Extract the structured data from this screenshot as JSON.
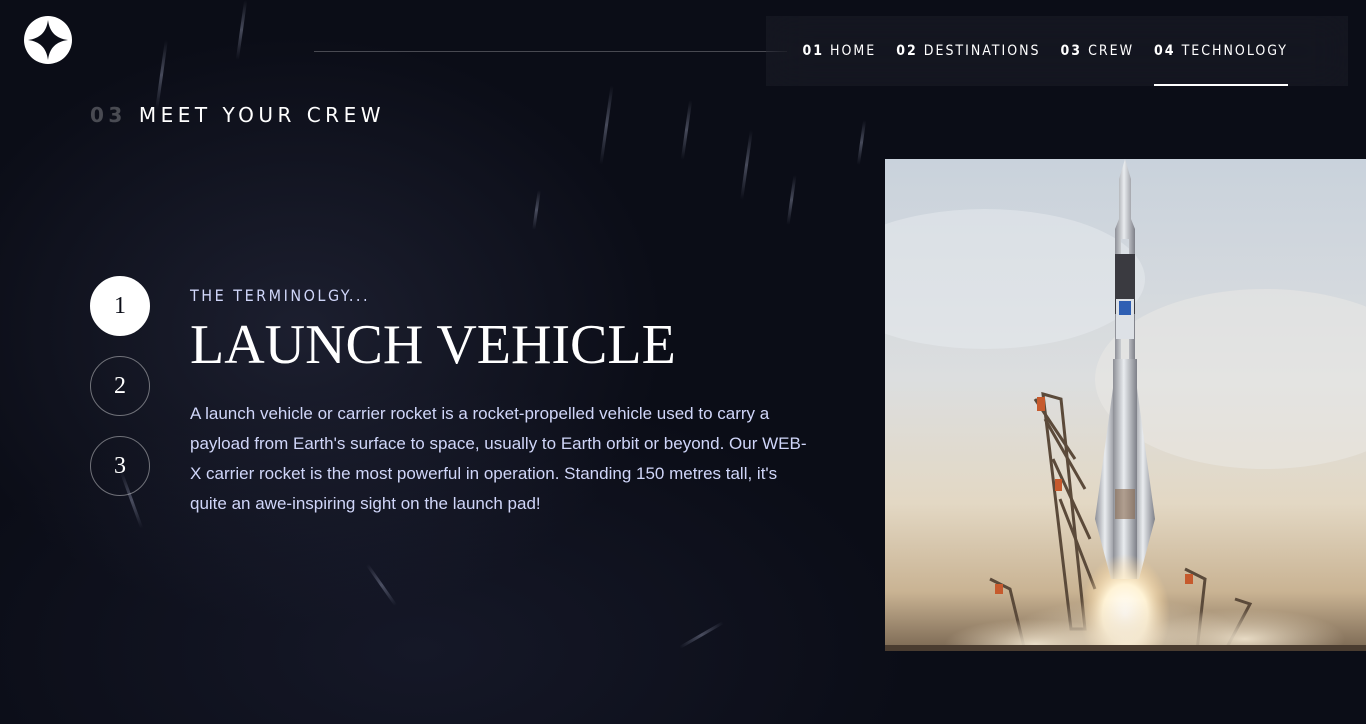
{
  "nav": {
    "items": [
      {
        "num": "01",
        "label": "HOME",
        "active": false
      },
      {
        "num": "02",
        "label": "DESTINATIONS",
        "active": false
      },
      {
        "num": "03",
        "label": "CREW",
        "active": false
      },
      {
        "num": "04",
        "label": "TECHNOLOGY",
        "active": true
      }
    ]
  },
  "page": {
    "heading_num": "03",
    "heading_label": "MEET YOUR CREW"
  },
  "pager": {
    "items": [
      "1",
      "2",
      "3"
    ],
    "active": 0
  },
  "content": {
    "eyebrow": "THE TERMINOLGY...",
    "title": "LAUNCH VEHICLE",
    "description": "A launch vehicle or carrier rocket is a rocket-propelled vehicle used to carry a payload from Earth's surface to space, usually to Earth orbit or beyond. Our WEB-X carrier rocket is the most powerful in operation. Standing 150 metres tall, it's quite an awe-inspiring sight on the launch pad!"
  },
  "image": {
    "alt": "launch-vehicle-photo"
  },
  "colors": {
    "background": "#0b0d17",
    "text_light": "#d0d6f9",
    "white": "#ffffff"
  },
  "icons": {
    "logo": "star-logo-icon"
  }
}
